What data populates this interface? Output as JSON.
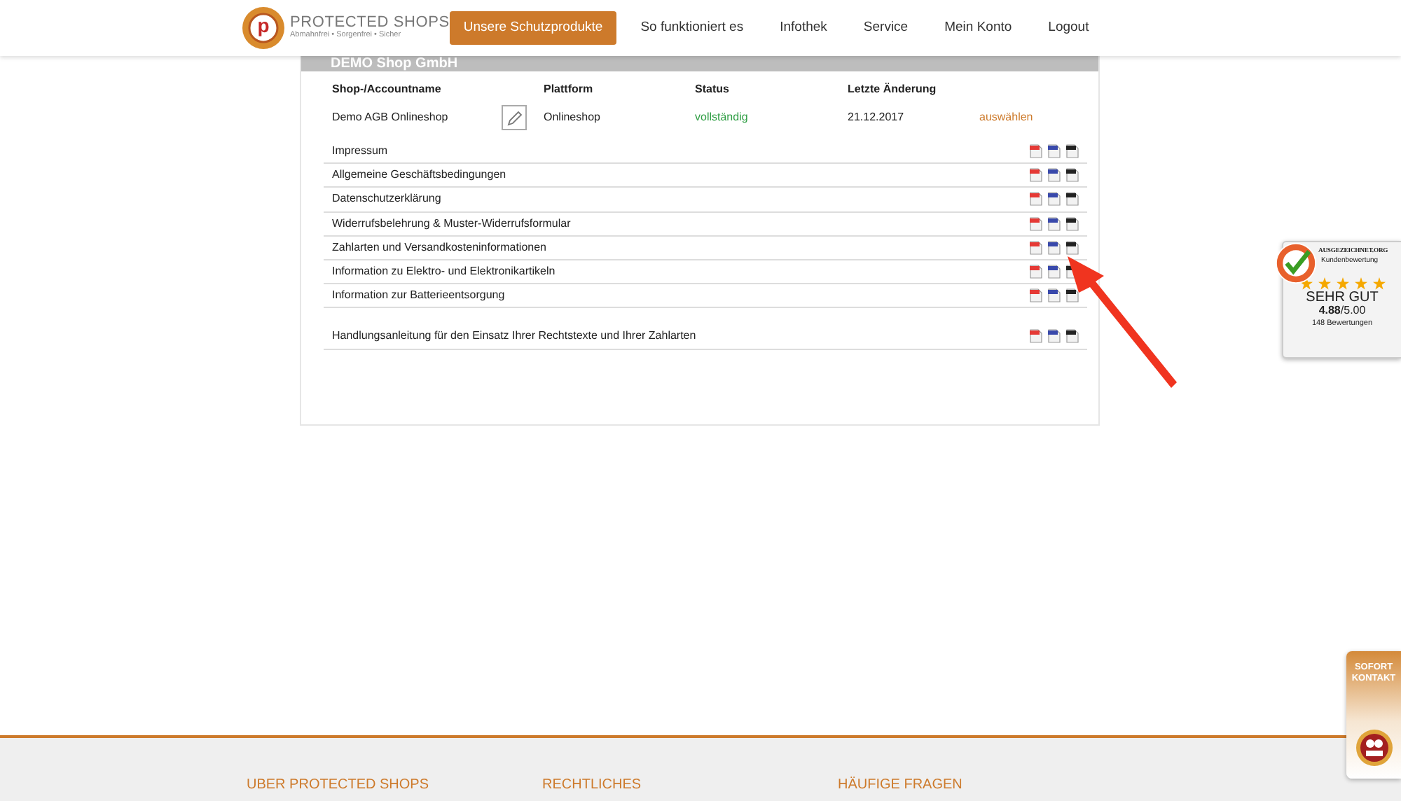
{
  "header": {
    "logo": {
      "mark": "p",
      "name": "PROTECTED SHOPS",
      "tagline": "Abmahnfrei • Sorgenfrei • Sicher"
    },
    "nav": [
      {
        "label": "Unsere Schutzprodukte",
        "selected": true
      },
      {
        "label": "So funktioniert es",
        "selected": false
      },
      {
        "label": "Infothek",
        "selected": false
      },
      {
        "label": "Service",
        "selected": false
      },
      {
        "label": "Mein Konto",
        "selected": false
      },
      {
        "label": "Logout",
        "selected": false
      }
    ]
  },
  "shop": {
    "title": "DEMO Shop GmbH",
    "columns": [
      "Shop-/Accountname",
      "Plattform",
      "Status",
      "Letzte Änderung"
    ],
    "rows": [
      {
        "name": "Demo AGB Onlineshop",
        "platform": "Onlineshop",
        "status": "vollständig",
        "date": "21.12.2017",
        "action": "auswählen"
      }
    ]
  },
  "documents": [
    {
      "title": "Impressum"
    },
    {
      "title": "Allgemeine Geschäftsbedingungen"
    },
    {
      "title": "Datenschutzerklärung"
    },
    {
      "title": "Widerrufsbelehrung & Muster-Widerrufsformular"
    },
    {
      "title": "Zahlarten und Versandkosteninformationen"
    },
    {
      "title": "Information zu Elektro- und Elektronikartikeln"
    },
    {
      "title": "Information zur Batterieentsorgung"
    }
  ],
  "guide": {
    "title": "Handlungsanleitung für den Einsatz Ihrer Rechtstexte und Ihrer Zahlarten"
  },
  "rating": {
    "brand": "AUSGEZEICHNET.ORG",
    "subtitle": "Kundenbewertung",
    "stars": 5,
    "verdict": "SEHR GUT",
    "score": "**4.88**/5.00",
    "count": "148 Bewertungen"
  },
  "contact": {
    "label": "SOFORT KONTAKT"
  },
  "footer": {
    "headings": [
      "UBER PROTECTED SHOPS",
      "RECHTLICHES",
      "HÄUFIGE FRAGEN"
    ]
  }
}
